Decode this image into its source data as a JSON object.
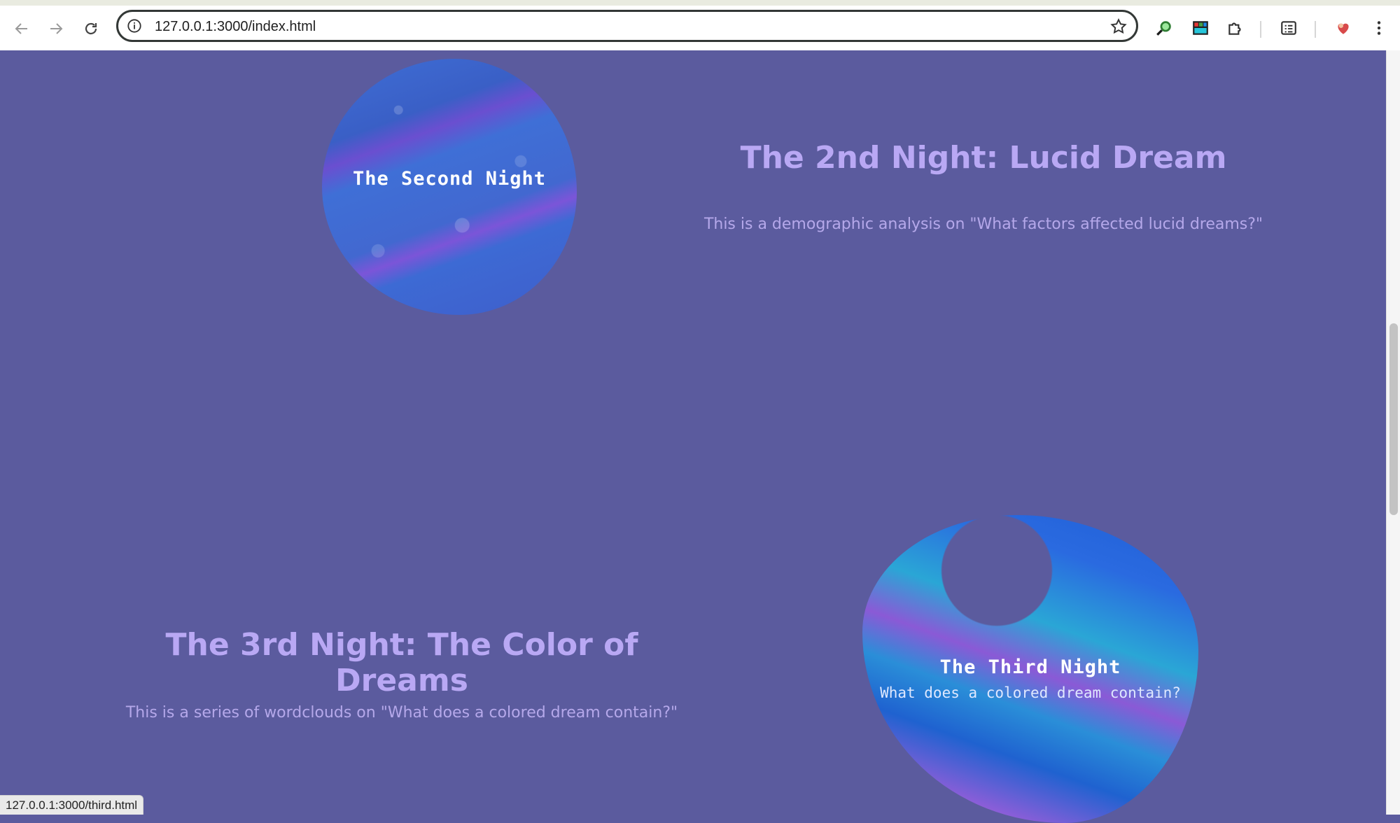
{
  "browser": {
    "url": "127.0.0.1:3000/index.html",
    "status_url": "127.0.0.1:3000/third.html"
  },
  "sections": [
    {
      "blob_title": "The Second Night",
      "heading": "The 2nd Night: Lucid Dream",
      "description": "This is a demographic analysis on \"What factors affected lucid dreams?\""
    },
    {
      "blob_title": "The Third Night",
      "blob_subtitle": "What does a colored dream contain?",
      "heading": "The 3rd Night: The Color of Dreams",
      "description": "This is a series of wordclouds on \"What does a colored dream contain?\""
    }
  ],
  "colors": {
    "page_background": "#5b5b9e",
    "heading": "#b9a8f4",
    "description": "#b5a8ea"
  }
}
